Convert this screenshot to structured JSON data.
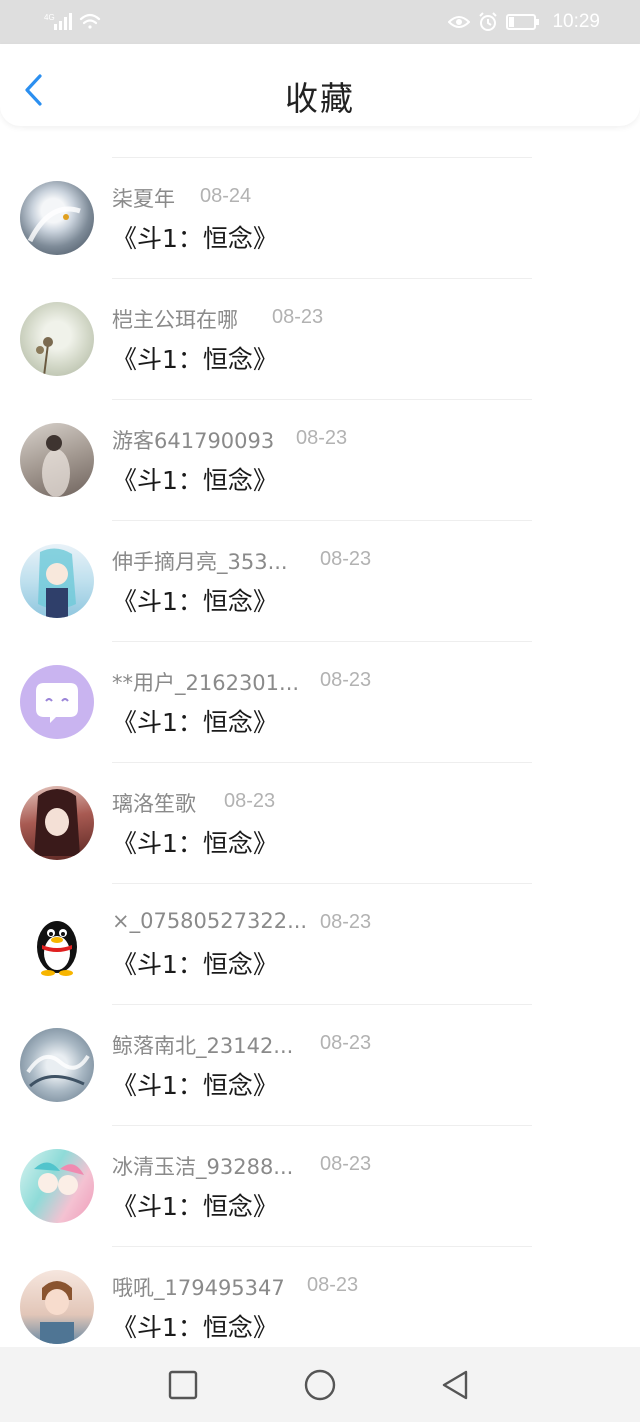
{
  "status_bar": {
    "network": "4G",
    "time": "10:29",
    "icons": [
      "signal-icon",
      "wifi-icon",
      "eye-icon",
      "alarm-icon",
      "battery-icon"
    ]
  },
  "header": {
    "title": "收藏",
    "back_icon": "chevron-left-icon"
  },
  "favorites": [
    {
      "name": "柒夏年",
      "date": "08-24",
      "title": "《斗1：恒念》"
    },
    {
      "name": "桤主公珥在哪",
      "date": "08-23",
      "title": "《斗1：恒念》"
    },
    {
      "name": "游客641790093",
      "date": "08-23",
      "title": "《斗1：恒念》"
    },
    {
      "name": "伸手摘月亮_353...",
      "date": "08-23",
      "title": "《斗1：恒念》"
    },
    {
      "name": "**用户_2162301...",
      "date": "08-23",
      "title": "《斗1：恒念》"
    },
    {
      "name": "璃洛笙歌",
      "date": "08-23",
      "title": "《斗1：恒念》"
    },
    {
      "name": "×_07580527322...",
      "date": "08-23",
      "title": "《斗1：恒念》"
    },
    {
      "name": "鲸落南北_23142...",
      "date": "08-23",
      "title": "《斗1：恒念》"
    },
    {
      "name": "冰清玉洁_93288...",
      "date": "08-23",
      "title": "《斗1：恒念》"
    },
    {
      "name": "哦吼_179495347",
      "date": "08-23",
      "title": "《斗1：恒念》"
    }
  ],
  "nav_bar": {
    "icons": [
      "recents-square-icon",
      "home-circle-icon",
      "back-triangle-icon"
    ]
  },
  "colors": {
    "accent": "#2b8ff0",
    "status_bar_bg": "#dedede",
    "name_text": "#8a8a8a",
    "date_text": "#b2b2b2"
  }
}
